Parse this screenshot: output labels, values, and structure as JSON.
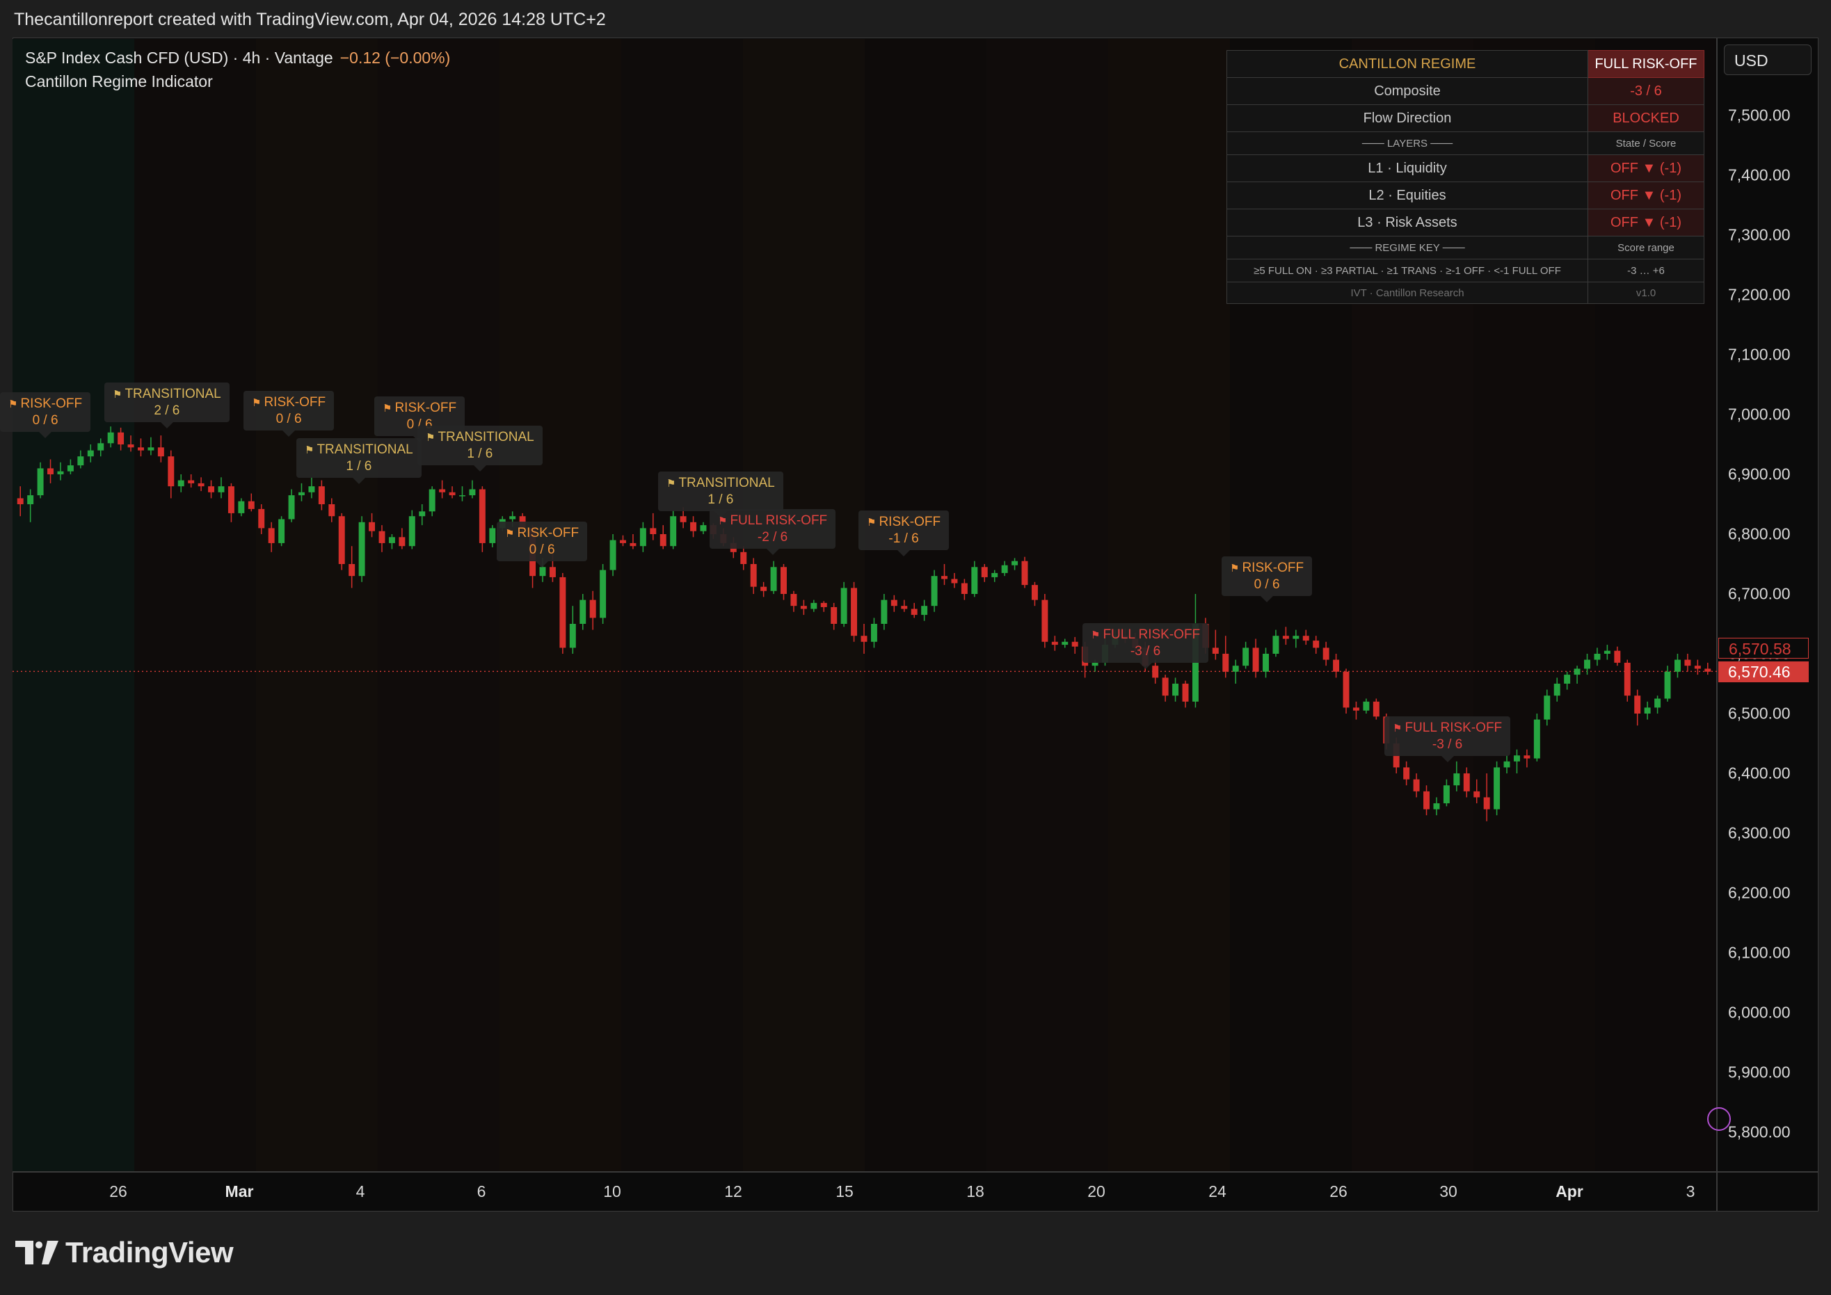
{
  "caption": "Thecantillonreport created with TradingView.com, Apr 04, 2026 14:28 UTC+2",
  "header": {
    "symbol_line": "S&P Index Cash CFD (USD) · 4h · Vantage",
    "change": "−0.12 (−0.00%)",
    "indicator": "Cantillon Regime Indicator"
  },
  "currency": "USD",
  "regime_table": {
    "title": "CANTILLON REGIME",
    "state": "FULL RISK-OFF",
    "composite_label": "Composite",
    "composite_value": "-3 / 6",
    "flow_label": "Flow Direction",
    "flow_value": "BLOCKED",
    "layers_label": "─── LAYERS ───",
    "layers_value": "State / Score",
    "l1_label": "L1 · Liquidity",
    "l1_value": "OFF ▼ (-1)",
    "l2_label": "L2 · Equities",
    "l2_value": "OFF ▼ (-1)",
    "l3_label": "L3 · Risk Assets",
    "l3_value": "OFF ▼ (-1)",
    "key_label": "─── REGIME KEY ───",
    "key_value": "Score range",
    "key_text": "≥5 FULL ON · ≥3 PARTIAL · ≥1 TRANS · ≥-1 OFF · <-1 FULL OFF",
    "key_range": "-3 … +6",
    "footer_label": "IVT · Cantillon Research",
    "footer_value": "v1.0"
  },
  "y_axis_labels": [
    "7,500.00",
    "7,400.00",
    "7,300.00",
    "7,200.00",
    "7,100.00",
    "7,000.00",
    "6,900.00",
    "6,800.00",
    "6,700.00",
    "6,600.00",
    "6,500.00",
    "6,400.00",
    "6,300.00",
    "6,200.00",
    "6,100.00",
    "6,000.00",
    "5,900.00",
    "5,800.00"
  ],
  "price_tags": {
    "upper": "6,570.58",
    "lower": "6,570.46"
  },
  "x_axis_labels": [
    "26",
    "Mar",
    "4",
    "6",
    "10",
    "12",
    "15",
    "18",
    "20",
    "24",
    "26",
    "30",
    "Apr",
    "3"
  ],
  "callouts": [
    {
      "label": "RISK-OFF",
      "score": "0 / 6"
    },
    {
      "label": "TRANSITIONAL",
      "score": "2 / 6"
    },
    {
      "label": "RISK-OFF",
      "score": "0 / 6"
    },
    {
      "label": "TRANSITIONAL",
      "score": "1 / 6"
    },
    {
      "label": "RISK-OFF",
      "score": "0 / 6"
    },
    {
      "label": "TRANSITIONAL",
      "score": "1 / 6"
    },
    {
      "label": "RISK-OFF",
      "score": "0 / 6"
    },
    {
      "label": "TRANSITIONAL",
      "score": "1 / 6"
    },
    {
      "label": "FULL RISK-OFF",
      "score": "-2 / 6"
    },
    {
      "label": "RISK-OFF",
      "score": "-1 / 6"
    },
    {
      "label": "RISK-OFF",
      "score": "0 / 6"
    },
    {
      "label": "FULL RISK-OFF",
      "score": "-3 / 6"
    },
    {
      "label": "FULL RISK-OFF",
      "score": "-3 / 6"
    }
  ],
  "logo_text": "TradingView",
  "colors": {
    "up": "#26a641",
    "down": "#d62f2b",
    "risk_off": "#f0943a",
    "transitional": "#d9b55a",
    "full_risk_off": "#e0433f"
  },
  "chart_data": {
    "type": "candlestick",
    "ylim": [
      5750,
      7600
    ],
    "last_price": 6570.46,
    "ohlc": [
      [
        6860,
        6880,
        6830,
        6850
      ],
      [
        6850,
        6875,
        6820,
        6865
      ],
      [
        6865,
        6920,
        6860,
        6910
      ],
      [
        6910,
        6925,
        6885,
        6900
      ],
      [
        6900,
        6920,
        6890,
        6905
      ],
      [
        6905,
        6925,
        6900,
        6915
      ],
      [
        6915,
        6940,
        6910,
        6930
      ],
      [
        6930,
        6950,
        6920,
        6940
      ],
      [
        6940,
        6960,
        6930,
        6952
      ],
      [
        6952,
        6980,
        6945,
        6970
      ],
      [
        6970,
        6978,
        6940,
        6950
      ],
      [
        6950,
        6965,
        6938,
        6945
      ],
      [
        6945,
        6960,
        6930,
        6940
      ],
      [
        6940,
        6962,
        6932,
        6945
      ],
      [
        6945,
        6965,
        6920,
        6930
      ],
      [
        6930,
        6940,
        6860,
        6880
      ],
      [
        6880,
        6900,
        6870,
        6890
      ],
      [
        6890,
        6900,
        6878,
        6885
      ],
      [
        6885,
        6895,
        6872,
        6880
      ],
      [
        6880,
        6890,
        6860,
        6870
      ],
      [
        6870,
        6895,
        6860,
        6880
      ],
      [
        6880,
        6885,
        6820,
        6835
      ],
      [
        6835,
        6860,
        6830,
        6855
      ],
      [
        6855,
        6868,
        6838,
        6842
      ],
      [
        6842,
        6850,
        6800,
        6810
      ],
      [
        6810,
        6820,
        6770,
        6785
      ],
      [
        6785,
        6830,
        6780,
        6825
      ],
      [
        6825,
        6875,
        6820,
        6865
      ],
      [
        6865,
        6885,
        6855,
        6870
      ],
      [
        6870,
        6895,
        6860,
        6880
      ],
      [
        6880,
        6890,
        6840,
        6850
      ],
      [
        6850,
        6860,
        6820,
        6830
      ],
      [
        6830,
        6835,
        6740,
        6750
      ],
      [
        6750,
        6780,
        6710,
        6730
      ],
      [
        6730,
        6830,
        6720,
        6820
      ],
      [
        6820,
        6835,
        6795,
        6805
      ],
      [
        6805,
        6815,
        6770,
        6785
      ],
      [
        6785,
        6800,
        6775,
        6795
      ],
      [
        6795,
        6810,
        6775,
        6780
      ],
      [
        6780,
        6840,
        6775,
        6830
      ],
      [
        6830,
        6850,
        6815,
        6838
      ],
      [
        6838,
        6880,
        6830,
        6875
      ],
      [
        6875,
        6890,
        6860,
        6870
      ],
      [
        6870,
        6880,
        6860,
        6865
      ],
      [
        6865,
        6880,
        6855,
        6865
      ],
      [
        6865,
        6890,
        6860,
        6875
      ],
      [
        6875,
        6880,
        6770,
        6785
      ],
      [
        6785,
        6815,
        6778,
        6810
      ],
      [
        6810,
        6830,
        6805,
        6825
      ],
      [
        6825,
        6838,
        6812,
        6830
      ],
      [
        6830,
        6835,
        6800,
        6810
      ],
      [
        6810,
        6815,
        6710,
        6730
      ],
      [
        6730,
        6760,
        6720,
        6745
      ],
      [
        6745,
        6770,
        6720,
        6728
      ],
      [
        6728,
        6735,
        6600,
        6610
      ],
      [
        6610,
        6680,
        6600,
        6650
      ],
      [
        6650,
        6700,
        6640,
        6690
      ],
      [
        6690,
        6705,
        6640,
        6660
      ],
      [
        6660,
        6750,
        6650,
        6740
      ],
      [
        6740,
        6800,
        6730,
        6790
      ],
      [
        6790,
        6798,
        6780,
        6785
      ],
      [
        6785,
        6800,
        6775,
        6780
      ],
      [
        6780,
        6820,
        6770,
        6810
      ],
      [
        6810,
        6835,
        6790,
        6800
      ],
      [
        6800,
        6815,
        6775,
        6780
      ],
      [
        6780,
        6840,
        6775,
        6830
      ],
      [
        6830,
        6845,
        6810,
        6820
      ],
      [
        6820,
        6830,
        6795,
        6805
      ],
      [
        6805,
        6820,
        6800,
        6815
      ],
      [
        6815,
        6818,
        6792,
        6800
      ],
      [
        6800,
        6810,
        6780,
        6785
      ],
      [
        6785,
        6795,
        6760,
        6770
      ],
      [
        6770,
        6780,
        6740,
        6750
      ],
      [
        6750,
        6760,
        6700,
        6712
      ],
      [
        6712,
        6720,
        6695,
        6705
      ],
      [
        6705,
        6755,
        6700,
        6745
      ],
      [
        6745,
        6750,
        6690,
        6700
      ],
      [
        6700,
        6705,
        6670,
        6680
      ],
      [
        6680,
        6690,
        6665,
        6675
      ],
      [
        6675,
        6690,
        6670,
        6685
      ],
      [
        6685,
        6688,
        6670,
        6678
      ],
      [
        6678,
        6685,
        6640,
        6650
      ],
      [
        6650,
        6720,
        6645,
        6710
      ],
      [
        6710,
        6720,
        6620,
        6630
      ],
      [
        6630,
        6650,
        6600,
        6620
      ],
      [
        6620,
        6660,
        6610,
        6650
      ],
      [
        6650,
        6700,
        6640,
        6690
      ],
      [
        6690,
        6698,
        6670,
        6680
      ],
      [
        6680,
        6690,
        6670,
        6675
      ],
      [
        6675,
        6685,
        6660,
        6665
      ],
      [
        6665,
        6690,
        6655,
        6680
      ],
      [
        6680,
        6740,
        6670,
        6730
      ],
      [
        6730,
        6750,
        6715,
        6725
      ],
      [
        6725,
        6735,
        6710,
        6718
      ],
      [
        6718,
        6725,
        6690,
        6700
      ],
      [
        6700,
        6755,
        6695,
        6745
      ],
      [
        6745,
        6750,
        6720,
        6728
      ],
      [
        6728,
        6740,
        6720,
        6735
      ],
      [
        6735,
        6755,
        6730,
        6748
      ],
      [
        6748,
        6760,
        6740,
        6755
      ],
      [
        6755,
        6762,
        6710,
        6715
      ],
      [
        6715,
        6720,
        6680,
        6690
      ],
      [
        6690,
        6700,
        6610,
        6620
      ],
      [
        6620,
        6630,
        6605,
        6615
      ],
      [
        6615,
        6625,
        6610,
        6620
      ],
      [
        6620,
        6628,
        6600,
        6612
      ],
      [
        6612,
        6620,
        6560,
        6580
      ],
      [
        6580,
        6590,
        6570,
        6585
      ],
      [
        6585,
        6625,
        6580,
        6615
      ],
      [
        6615,
        6640,
        6610,
        6630
      ],
      [
        6630,
        6642,
        6618,
        6625
      ],
      [
        6625,
        6635,
        6600,
        6610
      ],
      [
        6610,
        6620,
        6570,
        6580
      ],
      [
        6580,
        6590,
        6550,
        6560
      ],
      [
        6560,
        6565,
        6520,
        6530
      ],
      [
        6530,
        6560,
        6520,
        6550
      ],
      [
        6550,
        6555,
        6510,
        6520
      ],
      [
        6520,
        6700,
        6510,
        6650
      ],
      [
        6650,
        6660,
        6600,
        6610
      ],
      [
        6610,
        6640,
        6590,
        6600
      ],
      [
        6600,
        6630,
        6560,
        6570
      ],
      [
        6570,
        6590,
        6550,
        6580
      ],
      [
        6580,
        6620,
        6575,
        6610
      ],
      [
        6610,
        6625,
        6560,
        6570
      ],
      [
        6570,
        6610,
        6560,
        6600
      ],
      [
        6600,
        6640,
        6595,
        6630
      ],
      [
        6630,
        6645,
        6615,
        6625
      ],
      [
        6625,
        6640,
        6610,
        6630
      ],
      [
        6630,
        6640,
        6615,
        6622
      ],
      [
        6622,
        6630,
        6600,
        6610
      ],
      [
        6610,
        6620,
        6580,
        6590
      ],
      [
        6590,
        6600,
        6560,
        6570
      ],
      [
        6570,
        6575,
        6500,
        6510
      ],
      [
        6510,
        6520,
        6490,
        6505
      ],
      [
        6505,
        6525,
        6500,
        6520
      ],
      [
        6520,
        6525,
        6490,
        6495
      ],
      [
        6495,
        6500,
        6440,
        6450
      ],
      [
        6450,
        6460,
        6400,
        6410
      ],
      [
        6410,
        6420,
        6380,
        6390
      ],
      [
        6390,
        6400,
        6360,
        6370
      ],
      [
        6370,
        6380,
        6330,
        6340
      ],
      [
        6340,
        6360,
        6330,
        6350
      ],
      [
        6350,
        6390,
        6345,
        6380
      ],
      [
        6380,
        6420,
        6370,
        6400
      ],
      [
        6400,
        6410,
        6360,
        6370
      ],
      [
        6370,
        6390,
        6350,
        6360
      ],
      [
        6360,
        6400,
        6320,
        6340
      ],
      [
        6340,
        6420,
        6330,
        6410
      ],
      [
        6410,
        6430,
        6400,
        6420
      ],
      [
        6420,
        6440,
        6400,
        6430
      ],
      [
        6430,
        6440,
        6410,
        6425
      ],
      [
        6425,
        6500,
        6420,
        6490
      ],
      [
        6490,
        6540,
        6480,
        6530
      ],
      [
        6530,
        6560,
        6520,
        6550
      ],
      [
        6550,
        6570,
        6540,
        6565
      ],
      [
        6565,
        6580,
        6550,
        6575
      ],
      [
        6575,
        6600,
        6565,
        6590
      ],
      [
        6590,
        6610,
        6580,
        6600
      ],
      [
        6600,
        6615,
        6590,
        6605
      ],
      [
        6605,
        6612,
        6580,
        6585
      ],
      [
        6585,
        6590,
        6520,
        6530
      ],
      [
        6530,
        6540,
        6480,
        6500
      ],
      [
        6500,
        6520,
        6490,
        6510
      ],
      [
        6510,
        6530,
        6500,
        6525
      ],
      [
        6525,
        6580,
        6520,
        6570
      ],
      [
        6570,
        6600,
        6560,
        6590
      ],
      [
        6590,
        6600,
        6570,
        6580
      ],
      [
        6580,
        6590,
        6565,
        6575
      ],
      [
        6575,
        6585,
        6565,
        6570
      ]
    ]
  }
}
